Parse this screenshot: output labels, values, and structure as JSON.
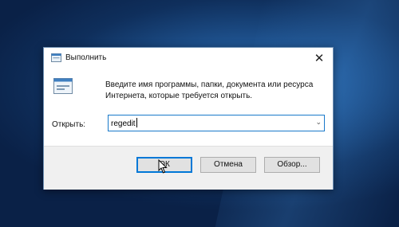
{
  "window": {
    "title": "Выполнить",
    "close_glyph": "✕",
    "icon": "run-icon"
  },
  "content": {
    "description": "Введите имя программы, папки, документа или ресурса Интернета, которые требуется открыть.",
    "open_label": "Открыть:",
    "input_value": "regedit"
  },
  "buttons": {
    "ok": "ОК",
    "cancel": "Отмена",
    "browse": "Обзор..."
  },
  "colors": {
    "accent": "#0078d7",
    "desktop": "#1d4f8a"
  }
}
